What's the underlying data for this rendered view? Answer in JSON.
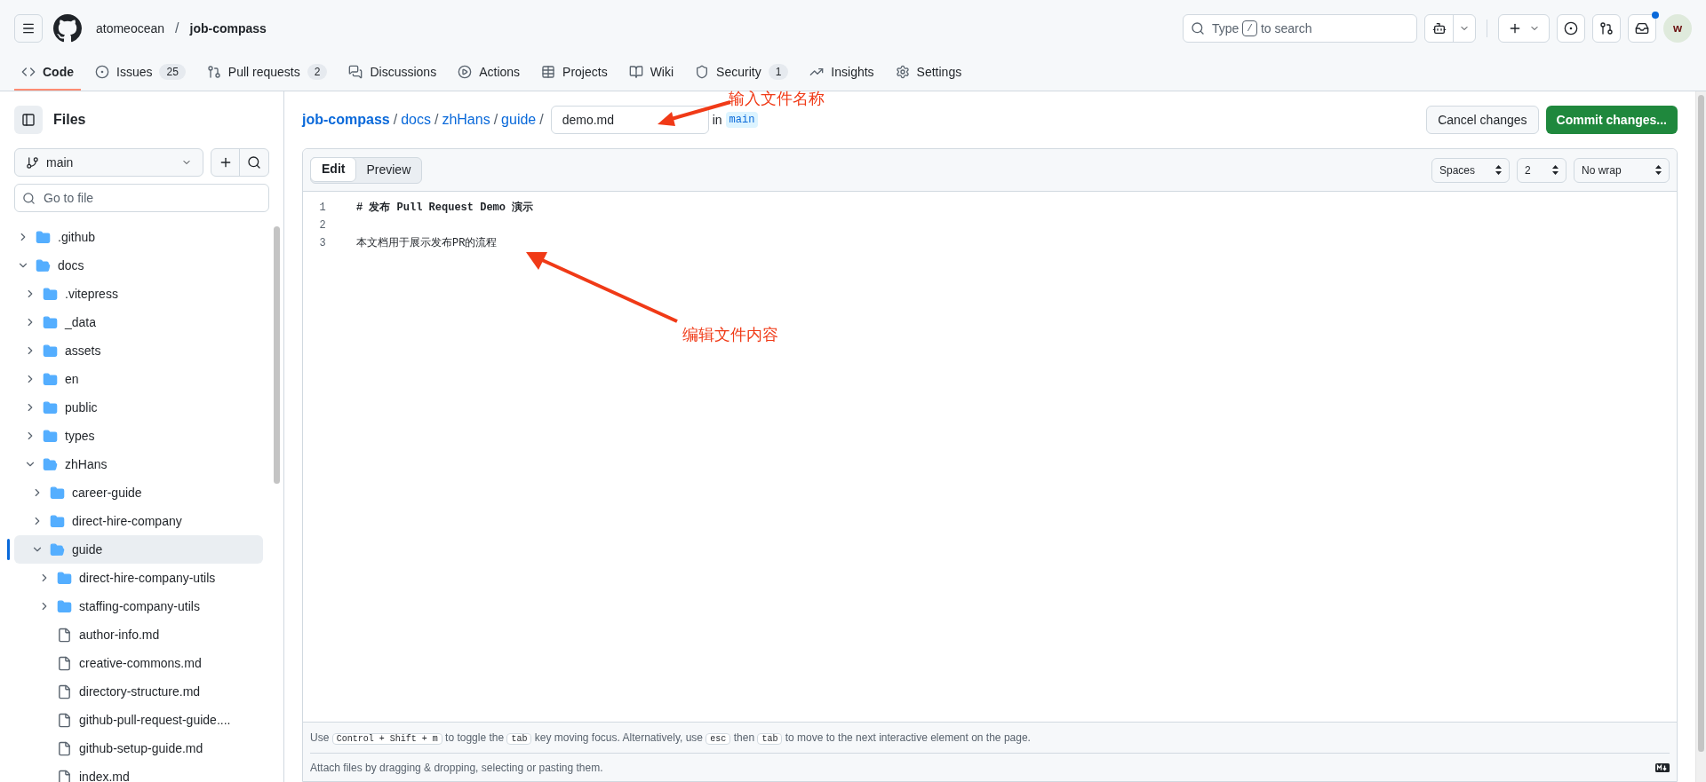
{
  "header": {
    "owner": "atomeocean",
    "repo": "job-compass",
    "search_placeholder_before": "Type",
    "search_key": "/",
    "search_placeholder_after": "to search",
    "avatar_initial": "w",
    "separator": "/",
    "notification_dot": true
  },
  "nav_tabs": [
    {
      "label": "Code",
      "selected": true
    },
    {
      "label": "Issues",
      "count": "25",
      "selected": false
    },
    {
      "label": "Pull requests",
      "count": "2",
      "selected": false
    },
    {
      "label": "Discussions",
      "selected": false
    },
    {
      "label": "Actions",
      "selected": false
    },
    {
      "label": "Projects",
      "selected": false
    },
    {
      "label": "Wiki",
      "selected": false
    },
    {
      "label": "Security",
      "count": "1",
      "selected": false
    },
    {
      "label": "Insights",
      "selected": false
    },
    {
      "label": "Settings",
      "selected": false
    }
  ],
  "sidebar": {
    "title": "Files",
    "branch": "main",
    "filter_placeholder": "Go to file",
    "tree": [
      {
        "name": ".github",
        "kind": "folder",
        "expanded": false,
        "selected": false
      },
      {
        "name": "docs",
        "kind": "folder",
        "expanded": true,
        "selected": false,
        "children": [
          {
            "name": ".vitepress",
            "kind": "folder",
            "expanded": false,
            "selected": false
          },
          {
            "name": "_data",
            "kind": "folder",
            "expanded": false,
            "selected": false
          },
          {
            "name": "assets",
            "kind": "folder",
            "expanded": false,
            "selected": false
          },
          {
            "name": "en",
            "kind": "folder",
            "expanded": false,
            "selected": false
          },
          {
            "name": "public",
            "kind": "folder",
            "expanded": false,
            "selected": false
          },
          {
            "name": "types",
            "kind": "folder",
            "expanded": false,
            "selected": false
          },
          {
            "name": "zhHans",
            "kind": "folder",
            "expanded": true,
            "selected": false,
            "children": [
              {
                "name": "career-guide",
                "kind": "folder",
                "expanded": false,
                "selected": false
              },
              {
                "name": "direct-hire-company",
                "kind": "folder",
                "expanded": false,
                "selected": false
              },
              {
                "name": "guide",
                "kind": "folder",
                "expanded": true,
                "selected": true,
                "children": [
                  {
                    "name": "direct-hire-company-utils",
                    "kind": "folder",
                    "expanded": false,
                    "selected": false
                  },
                  {
                    "name": "staffing-company-utils",
                    "kind": "folder",
                    "expanded": false,
                    "selected": false
                  },
                  {
                    "name": "author-info.md",
                    "kind": "file",
                    "selected": false
                  },
                  {
                    "name": "creative-commons.md",
                    "kind": "file",
                    "selected": false
                  },
                  {
                    "name": "directory-structure.md",
                    "kind": "file",
                    "selected": false
                  },
                  {
                    "name": "github-pull-request-guide....",
                    "kind": "file",
                    "selected": false
                  },
                  {
                    "name": "github-setup-guide.md",
                    "kind": "file",
                    "selected": false
                  },
                  {
                    "name": "index.md",
                    "kind": "file",
                    "selected": false
                  }
                ]
              }
            ]
          }
        ]
      }
    ]
  },
  "path": {
    "segments": [
      "job-compass",
      "docs",
      "zhHans",
      "guide"
    ],
    "separator": "/",
    "file_name": "demo.md",
    "in_label": "in",
    "branch": "main"
  },
  "actions": {
    "cancel": "Cancel changes",
    "commit": "Commit changes..."
  },
  "editor": {
    "tabs": [
      {
        "label": "Edit",
        "selected": true
      },
      {
        "label": "Preview",
        "selected": false
      }
    ],
    "indent_mode": "Spaces",
    "indent_size": "2",
    "wrap_mode": "No wrap",
    "lines": [
      {
        "number": "1",
        "text": "# 发布 Pull Request Demo 演示",
        "kind": "heading"
      },
      {
        "number": "2"
      },
      {
        "number": "3",
        "text": "本文档用于展示发布PR的流程",
        "kind": "plain"
      }
    ],
    "hint": [
      {
        "text": "Use "
      },
      {
        "kbd": "Control + Shift + m"
      },
      {
        "text": " to toggle the "
      },
      {
        "kbd": "tab"
      },
      {
        "text": " key moving focus. Alternatively, use "
      },
      {
        "kbd": "esc"
      },
      {
        "text": " then "
      },
      {
        "kbd": "tab"
      },
      {
        "text": " to move to the next interactive element on the page."
      }
    ],
    "attach": "Attach files by dragging & dropping, selecting or pasting them."
  },
  "annotations": [
    {
      "text": "输入文件名称"
    },
    {
      "text": "编辑文件内容"
    }
  ]
}
